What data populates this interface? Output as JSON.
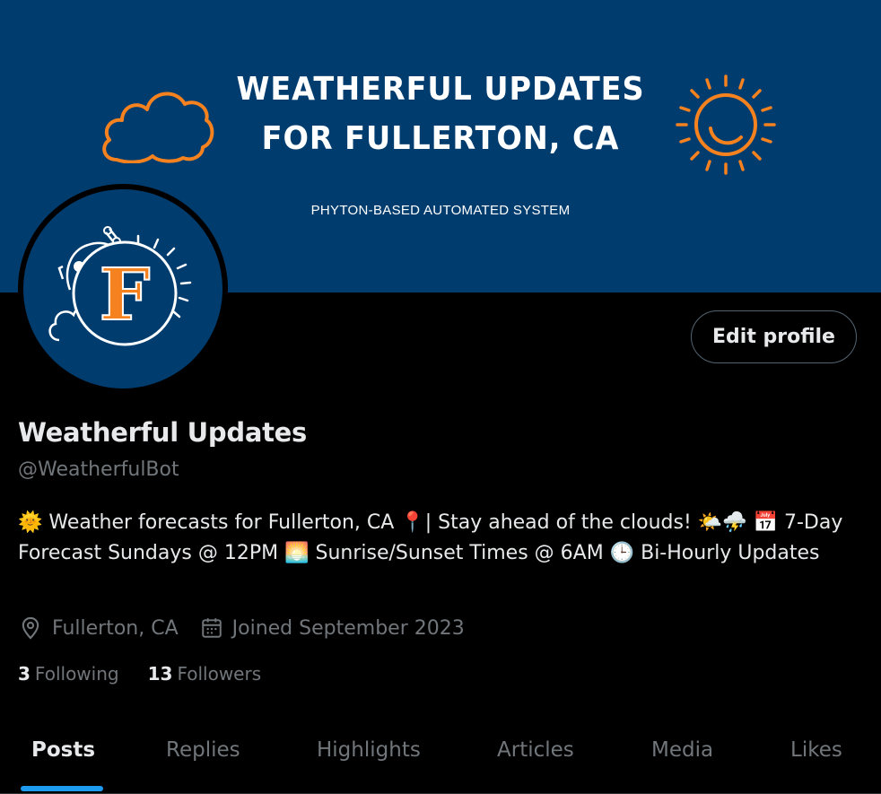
{
  "banner": {
    "title_line1": "WEATHERFUL UPDATES",
    "title_line2": "FOR FULLERTON, CA",
    "subtitle": "PHYTON-BASED AUTOMATED SYSTEM"
  },
  "avatar": {
    "letter": "F"
  },
  "profile": {
    "edit_button": "Edit profile",
    "name": "Weatherful Updates",
    "handle": "@WeatherfulBot",
    "bio": {
      "e1": "🌞",
      "t1": " Weather forecasts for Fullerton, CA ",
      "e2": "📍",
      "t2": "| Stay ahead of the clouds! ",
      "e3": "🌤️⛈️",
      "t3": " ",
      "e4": "📅",
      "t4": " 7-Day Forecast Sundays @ 12PM ",
      "e5": "🌅",
      "t5": " Sunrise/Sunset Times @ 6AM ",
      "e6": "🕒",
      "t6": " Bi-Hourly Updates"
    },
    "location": "Fullerton, CA",
    "joined": "Joined September 2023",
    "following_count": "3",
    "following_label": "Following",
    "followers_count": "13",
    "followers_label": "Followers"
  },
  "tabs": [
    "Posts",
    "Replies",
    "Highlights",
    "Articles",
    "Media",
    "Likes"
  ],
  "active_tab": "Posts",
  "colors": {
    "banner_bg": "#003c6e",
    "accent_orange": "#f5821f",
    "tab_underline": "#1d9bf0",
    "muted_text": "#71767b"
  },
  "icons": {
    "location": "location-pin-icon",
    "calendar": "calendar-icon",
    "cloud": "cloud-icon",
    "sun": "sun-icon"
  }
}
